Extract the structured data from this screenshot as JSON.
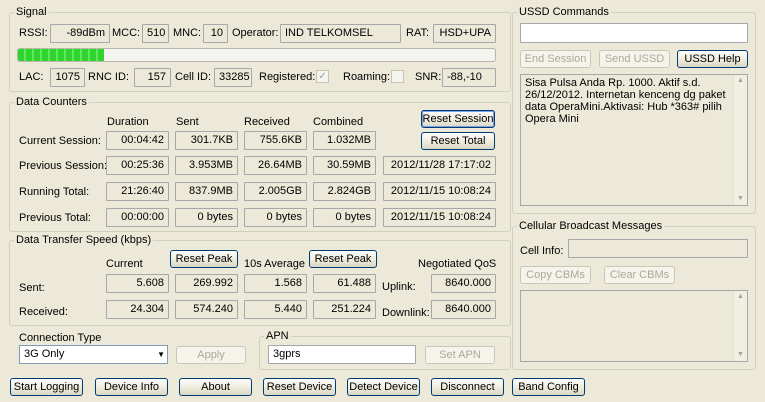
{
  "signal": {
    "legend": "Signal",
    "rssi_label": "RSSI:",
    "rssi": "-89dBm",
    "mcc_label": "MCC:",
    "mcc": "510",
    "mnc_label": "MNC:",
    "mnc": "10",
    "operator_label": "Operator:",
    "operator": "IND TELKOMSEL",
    "rat_label": "RAT:",
    "rat": "HSD+UPA",
    "strength_fraction": 0.18,
    "lac_label": "LAC:",
    "lac": "1075",
    "rnc_label": "RNC ID:",
    "rnc": "157",
    "cellid_label": "Cell ID:",
    "cellid": "33285",
    "registered_label": "Registered:",
    "registered_mark": "✓",
    "roaming_label": "Roaming:",
    "snr_label": "SNR:",
    "snr": "-88,-10"
  },
  "counters": {
    "legend": "Data Counters",
    "headers": [
      "Duration",
      "Sent",
      "Received",
      "Combined"
    ],
    "reset_session": "Reset Session",
    "reset_total": "Reset Total",
    "rows": [
      {
        "label": "Current Session:",
        "duration": "00:04:42",
        "sent": "301.7KB",
        "received": "755.6KB",
        "combined": "1.032MB",
        "stamp": ""
      },
      {
        "label": "Previous Session:",
        "duration": "00:25:36",
        "sent": "3.953MB",
        "received": "26.64MB",
        "combined": "30.59MB",
        "stamp": "2012/11/28 17:17:02"
      },
      {
        "label": "Running Total:",
        "duration": "21:26:40",
        "sent": "837.9MB",
        "received": "2.005GB",
        "combined": "2.824GB",
        "stamp": "2012/11/15 10:08:24"
      },
      {
        "label": "Previous Total:",
        "duration": "00:00:00",
        "sent": "0 bytes",
        "received": "0 bytes",
        "combined": "0 bytes",
        "stamp": "2012/11/15 10:08:24"
      }
    ]
  },
  "speed": {
    "legend": "Data Transfer Speed (kbps)",
    "current_label": "Current",
    "reset_peak": "Reset Peak",
    "avg_label": "10s Average",
    "qos_label": "Negotiated QoS",
    "sent_label": "Sent:",
    "received_label": "Received:",
    "uplink_label": "Uplink:",
    "downlink_label": "Downlink:",
    "sent": {
      "current": "5.608",
      "peak": "269.992",
      "avg": "1.568",
      "peak2": "61.488",
      "qos": "8640.000"
    },
    "received": {
      "current": "24.304",
      "peak": "574.240",
      "avg": "5.440",
      "peak2": "251.224",
      "qos": "8640.000"
    }
  },
  "connection": {
    "legend": "Connection Type",
    "selected": "3G Only",
    "apply": "Apply"
  },
  "apn": {
    "legend": "APN",
    "value": "3gprs",
    "set_apn": "Set APN"
  },
  "ussd": {
    "legend": "USSD Commands",
    "input": "",
    "end_session": "End Session",
    "send_ussd": "Send USSD",
    "ussd_help": "USSD Help",
    "response": "Sisa Pulsa Anda Rp. 1000. Aktif s.d. 26/12/2012. Internetan kenceng dg paket data OperaMini.Aktivasi: Hub *363# pilih Opera Mini"
  },
  "cbm": {
    "legend": "Cellular Broadcast Messages",
    "cell_info_label": "Cell Info:",
    "cell_info": "",
    "copy": "Copy CBMs",
    "clear": "Clear CBMs"
  },
  "footer": {
    "start_logging": "Start Logging",
    "device_info": "Device Info",
    "about": "About",
    "reset_device": "Reset Device",
    "detect_device": "Detect Device",
    "disconnect": "Disconnect",
    "band_config": "Band Config"
  }
}
